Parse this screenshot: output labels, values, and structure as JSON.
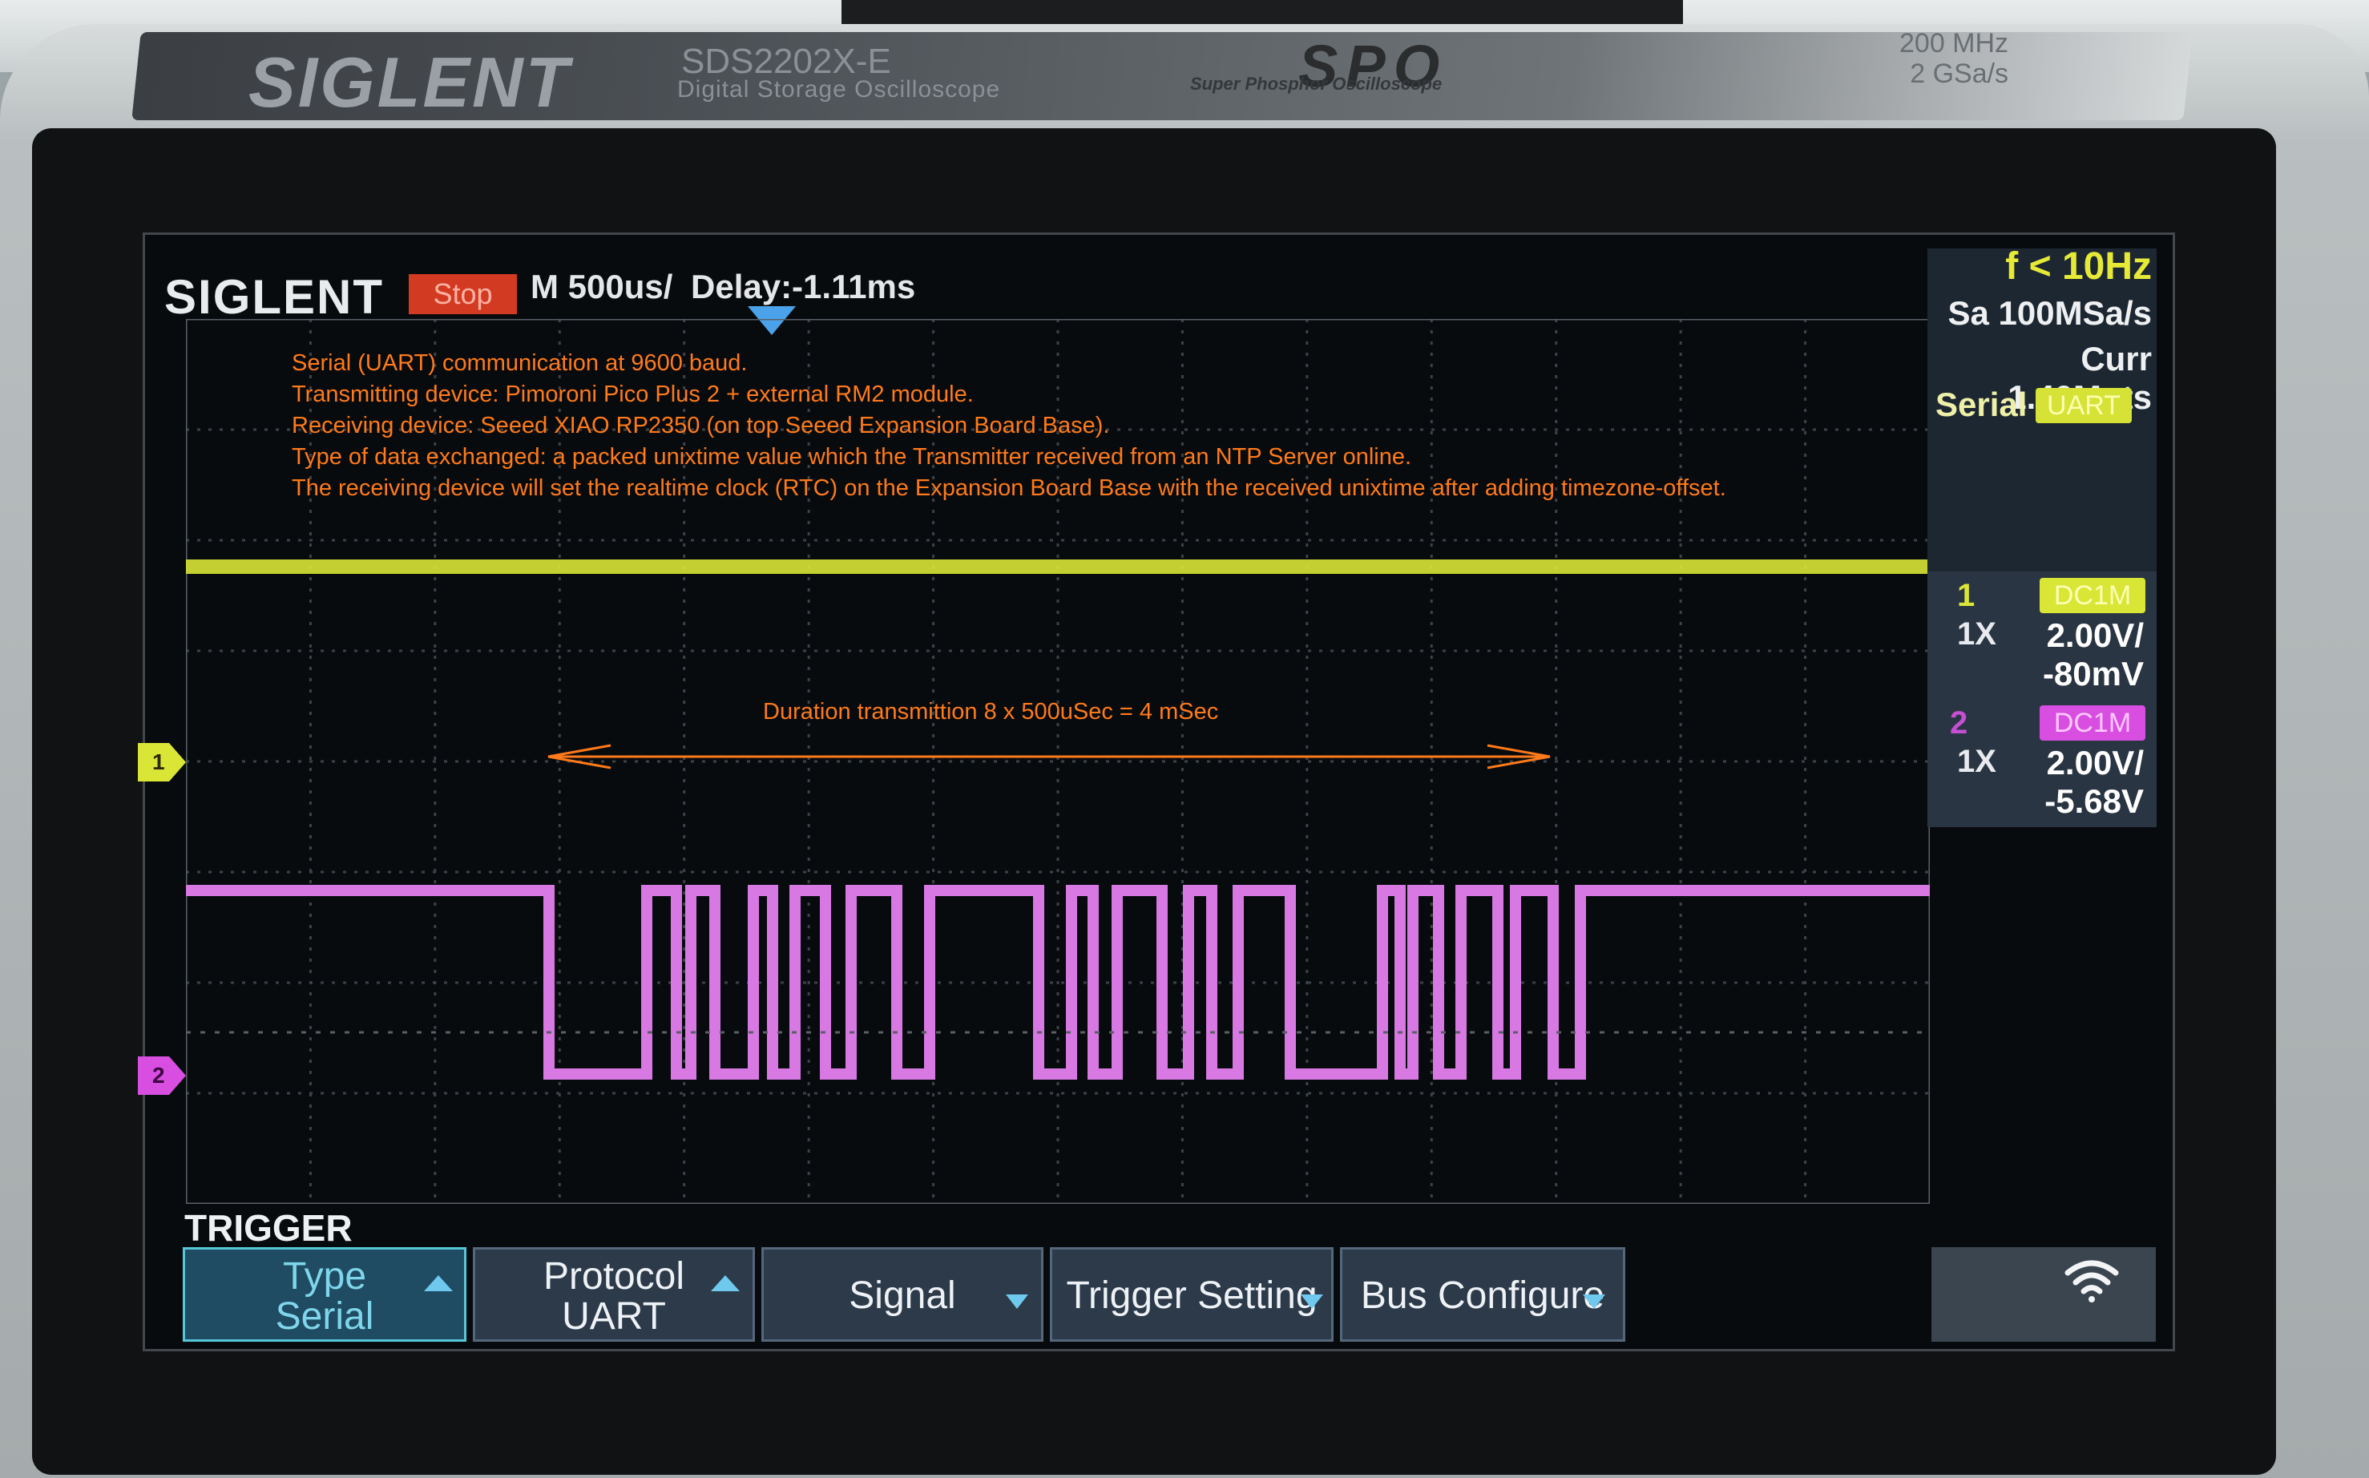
{
  "device": {
    "brand": "SIGLENT",
    "model": "SDS2202X-E",
    "model_desc": "Digital Storage Oscilloscope",
    "spo": "SPO",
    "spo_desc": "Super Phosphor Oscilloscope",
    "bandwidth": "200 MHz",
    "sample_rate_spec": "2 GSa/s"
  },
  "status_bar": {
    "logo": "SIGLENT",
    "run_state": "Stop",
    "timebase": "M 500us/",
    "delay": "Delay:-1.11ms"
  },
  "info_panel": {
    "frequency": "f < 10Hz",
    "sample_rate": "Sa 100MSa/s",
    "memory_depth": "Curr 1.40Mpts",
    "trigger_label": "Serial",
    "trigger_protocol": "UART"
  },
  "channels": [
    {
      "number": "1",
      "coupling": "DC1M",
      "probe": "1X",
      "volts_div": "2.00V/",
      "offset": "-80mV",
      "color": "#d9e636"
    },
    {
      "number": "2",
      "coupling": "DC1M",
      "probe": "1X",
      "volts_div": "2.00V/",
      "offset": "-5.68V",
      "color": "#d74ee0"
    }
  ],
  "annotation_lines": [
    "Serial (UART) communication at 9600 baud.",
    "Transmitting device: Pimoroni Pico Plus 2 + external RM2 module.",
    "Receiving device: Seeed XIAO RP2350 (on top Seeed Expansion Board Base).",
    "Type of data exchanged: a packed unixtime value which the Transmitter received from an NTP Server online.",
    "The receiving device will set the realtime clock (RTC) on the Expansion Board Base with the received unixtime after adding timezone-offset."
  ],
  "duration_note": "Duration transmittion 8 x 500uSec = 4 mSec",
  "softkeys": {
    "title": "TRIGGER",
    "type_label": "Type",
    "type_value": "Serial",
    "protocol_label": "Protocol",
    "protocol_value": "UART",
    "signal": "Signal",
    "trigger_setting": "Trigger Setting",
    "bus_configure": "Bus Configure"
  },
  "accent_colors": {
    "annotation": "#ff7a1a",
    "ch1": "#d9e636",
    "ch2": "#d74ee0",
    "stop": "#d33a22",
    "delay_marker": "#4aa3ea"
  }
}
